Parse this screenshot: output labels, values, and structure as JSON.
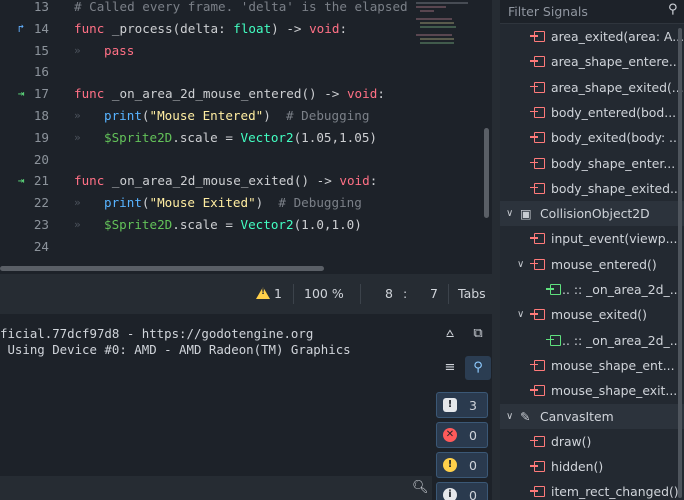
{
  "editor": {
    "lines": [
      {
        "num": "13",
        "mark": "",
        "parts": [
          {
            "c": "cm",
            "t": "# Called every frame. 'delta' is the elapsed"
          }
        ]
      },
      {
        "num": "14",
        "mark": "override",
        "parts": [
          {
            "c": "kw",
            "t": "func "
          },
          {
            "c": "pl",
            "t": "_process(delta: "
          },
          {
            "c": "ty",
            "t": "float"
          },
          {
            "c": "pl",
            "t": ") -> "
          },
          {
            "c": "kw",
            "t": "void"
          },
          {
            "c": "pl",
            "t": ":"
          }
        ]
      },
      {
        "num": "15",
        "mark": "",
        "indent": true,
        "parts": [
          {
            "c": "kw",
            "t": "pass"
          }
        ]
      },
      {
        "num": "16",
        "mark": "",
        "parts": []
      },
      {
        "num": "17",
        "mark": "signal",
        "parts": [
          {
            "c": "kw",
            "t": "func "
          },
          {
            "c": "pl",
            "t": "_on_area_2d_mouse_entered() -> "
          },
          {
            "c": "kw",
            "t": "void"
          },
          {
            "c": "pl",
            "t": ":"
          }
        ]
      },
      {
        "num": "18",
        "mark": "",
        "indent": true,
        "parts": [
          {
            "c": "fn",
            "t": "print"
          },
          {
            "c": "pl",
            "t": "("
          },
          {
            "c": "st",
            "t": "\"Mouse Entered\""
          },
          {
            "c": "pl",
            "t": ")  "
          },
          {
            "c": "cm",
            "t": "# Debugging"
          }
        ]
      },
      {
        "num": "19",
        "mark": "",
        "indent": true,
        "parts": [
          {
            "c": "nd",
            "t": "$Sprite2D"
          },
          {
            "c": "pl",
            "t": ".scale = "
          },
          {
            "c": "ty",
            "t": "Vector2"
          },
          {
            "c": "pl",
            "t": "(1.05,1.05)"
          }
        ]
      },
      {
        "num": "20",
        "mark": "",
        "parts": []
      },
      {
        "num": "21",
        "mark": "signal",
        "parts": [
          {
            "c": "kw",
            "t": "func "
          },
          {
            "c": "pl",
            "t": "_on_area_2d_mouse_exited() -> "
          },
          {
            "c": "kw",
            "t": "void"
          },
          {
            "c": "pl",
            "t": ":"
          }
        ]
      },
      {
        "num": "22",
        "mark": "",
        "indent": true,
        "parts": [
          {
            "c": "fn",
            "t": "print"
          },
          {
            "c": "pl",
            "t": "("
          },
          {
            "c": "st",
            "t": "\"Mouse Exited\""
          },
          {
            "c": "pl",
            "t": ")  "
          },
          {
            "c": "cm",
            "t": "# Debugging"
          }
        ]
      },
      {
        "num": "23",
        "mark": "",
        "indent": true,
        "parts": [
          {
            "c": "nd",
            "t": "$Sprite2D"
          },
          {
            "c": "pl",
            "t": ".scale = "
          },
          {
            "c": "ty",
            "t": "Vector2"
          },
          {
            "c": "pl",
            "t": "(1.0,1.0)"
          }
        ]
      },
      {
        "num": "24",
        "mark": "",
        "parts": []
      }
    ]
  },
  "statusbar": {
    "warnings": "1",
    "zoom": "100 %",
    "line": "8",
    "sep": ":",
    "col": "7",
    "indent_mode": "Tabs"
  },
  "output": {
    "lines": [
      "ficial.77dcf97d8 - https://godotengine.org",
      " Using Device #0: AMD - AMD Radeon(TM) Graphics"
    ],
    "filters": {
      "messages": "3",
      "errors": "0",
      "warnings": "0",
      "info": "0"
    }
  },
  "dock": {
    "filter_placeholder": "Filter Signals",
    "rows": [
      {
        "kind": "sig",
        "label": "area_exited(area: A..."
      },
      {
        "kind": "sig",
        "label": "area_shape_entere..."
      },
      {
        "kind": "sig",
        "label": "area_shape_exited(..."
      },
      {
        "kind": "sig",
        "label": "body_entered(bod..."
      },
      {
        "kind": "sig",
        "label": "body_exited(body: ..."
      },
      {
        "kind": "sig",
        "label": "body_shape_enter..."
      },
      {
        "kind": "sig",
        "label": "body_shape_exited..."
      },
      {
        "kind": "class",
        "label": "CollisionObject2D"
      },
      {
        "kind": "sig",
        "label": "input_event(viewp..."
      },
      {
        "kind": "sigexp",
        "label": "mouse_entered()"
      },
      {
        "kind": "conn",
        "label": ".. :: _on_area_2d_..."
      },
      {
        "kind": "sigexp",
        "label": "mouse_exited()"
      },
      {
        "kind": "conn",
        "label": ".. :: _on_area_2d_..."
      },
      {
        "kind": "sig",
        "label": "mouse_shape_ent..."
      },
      {
        "kind": "sig",
        "label": "mouse_shape_exit..."
      },
      {
        "kind": "class",
        "label": "CanvasItem"
      },
      {
        "kind": "sig",
        "label": "draw()"
      },
      {
        "kind": "sig",
        "label": "hidden()"
      },
      {
        "kind": "sig",
        "label": "item_rect_changed()"
      }
    ]
  }
}
